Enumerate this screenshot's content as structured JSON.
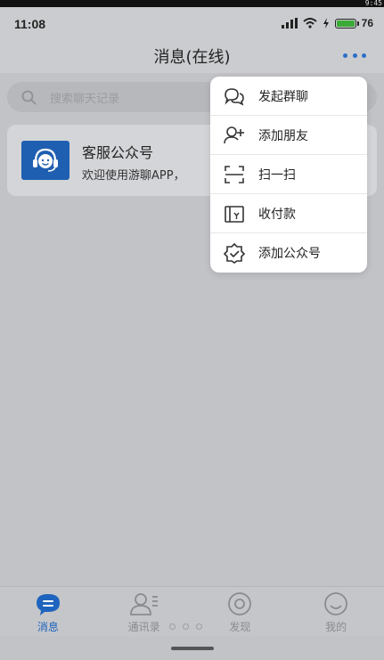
{
  "status_bar": {
    "time": "11:08",
    "battery": "76",
    "corner_time": "9:45",
    "accent_color": "#3aa935"
  },
  "header": {
    "title": "消息(在线)",
    "more_icon": "more-dots-icon",
    "accent_color": "#2c6ec8"
  },
  "search": {
    "placeholder": "搜索聊天记录",
    "icon": "search-icon"
  },
  "conversations": [
    {
      "name": "客服公众号",
      "preview": "欢迎使用游聊APP，",
      "avatar_icon": "customer-service-icon",
      "avatar_color": "#1f5fb1"
    }
  ],
  "menu": {
    "items": [
      {
        "label": "发起群聊",
        "icon": "group-chat-icon"
      },
      {
        "label": "添加朋友",
        "icon": "add-friend-icon"
      },
      {
        "label": "扫一扫",
        "icon": "scan-icon"
      },
      {
        "label": "收付款",
        "icon": "payment-icon"
      },
      {
        "label": "添加公众号",
        "icon": "add-official-account-icon"
      }
    ]
  },
  "tabs": [
    {
      "label": "消息",
      "icon": "message-icon",
      "active": true
    },
    {
      "label": "通讯录",
      "icon": "contacts-icon",
      "active": false
    },
    {
      "label": "发现",
      "icon": "discover-icon",
      "active": false
    },
    {
      "label": "我的",
      "icon": "profile-icon",
      "active": false
    }
  ],
  "colors": {
    "tab_active": "#1e64be",
    "tab_inactive": "#8a8b8f"
  }
}
